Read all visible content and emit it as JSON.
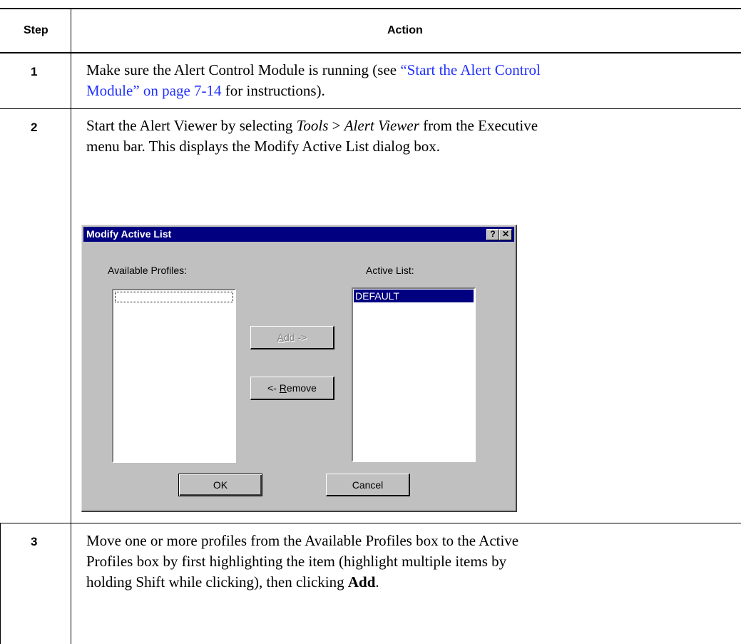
{
  "table": {
    "header_step": "Step",
    "header_action": "Action"
  },
  "rows": [
    {
      "step": "1",
      "text_before": "Make sure the Alert Control Module is running (see ",
      "link_line1": "“Start the Alert Control",
      "link_line2": "Module” on page 7-14",
      "text_after": " for instructions)."
    },
    {
      "step": "2",
      "line1_a": "Start the Alert Viewer by selecting ",
      "line1_tools": "Tools",
      "line1_sep": " > ",
      "line1_menu": "Alert Viewer",
      "line1_b": " from the Executive",
      "line2": "menu bar. This displays the Modify Active List dialog box."
    },
    {
      "step": "3",
      "line1": "Move one or more profiles from the Available Profiles box to the Active",
      "line2": "Profiles box by first highlighting the item (highlight multiple items by",
      "line3_a": "holding Shift while clicking), then clicking ",
      "line3_bold": "Add",
      "line3_b": "."
    }
  ],
  "dialog": {
    "title": "Modify Active List",
    "help_glyph": "?",
    "close_glyph": "✕",
    "available_label": "Available Profiles:",
    "active_label": "Active List:",
    "active_items": [
      "DEFAULT"
    ],
    "add_button": {
      "mnemonic": "A",
      "rest": "dd ->"
    },
    "remove_button": {
      "prefix": "<- ",
      "mnemonic": "R",
      "rest": "emove"
    },
    "ok_button": "OK",
    "cancel_button": "Cancel"
  },
  "colors": {
    "link": "#2030ff",
    "titlebar": "#000080",
    "dialog_face": "#c0c0c0"
  }
}
